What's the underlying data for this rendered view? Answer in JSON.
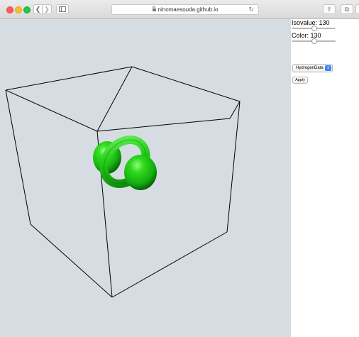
{
  "browser": {
    "address": "ninomaesouda.github.io"
  },
  "panel": {
    "isovalue_label": "Isovalue: 130",
    "isovalue": 130,
    "color_label": "Color: 130",
    "color": 130,
    "dataset_selected": "HydrogenData",
    "apply_label": "Apply"
  },
  "colors": {
    "background": "#d5dde2",
    "isosurface": "#1fc41f",
    "box_lines": "#000000"
  }
}
